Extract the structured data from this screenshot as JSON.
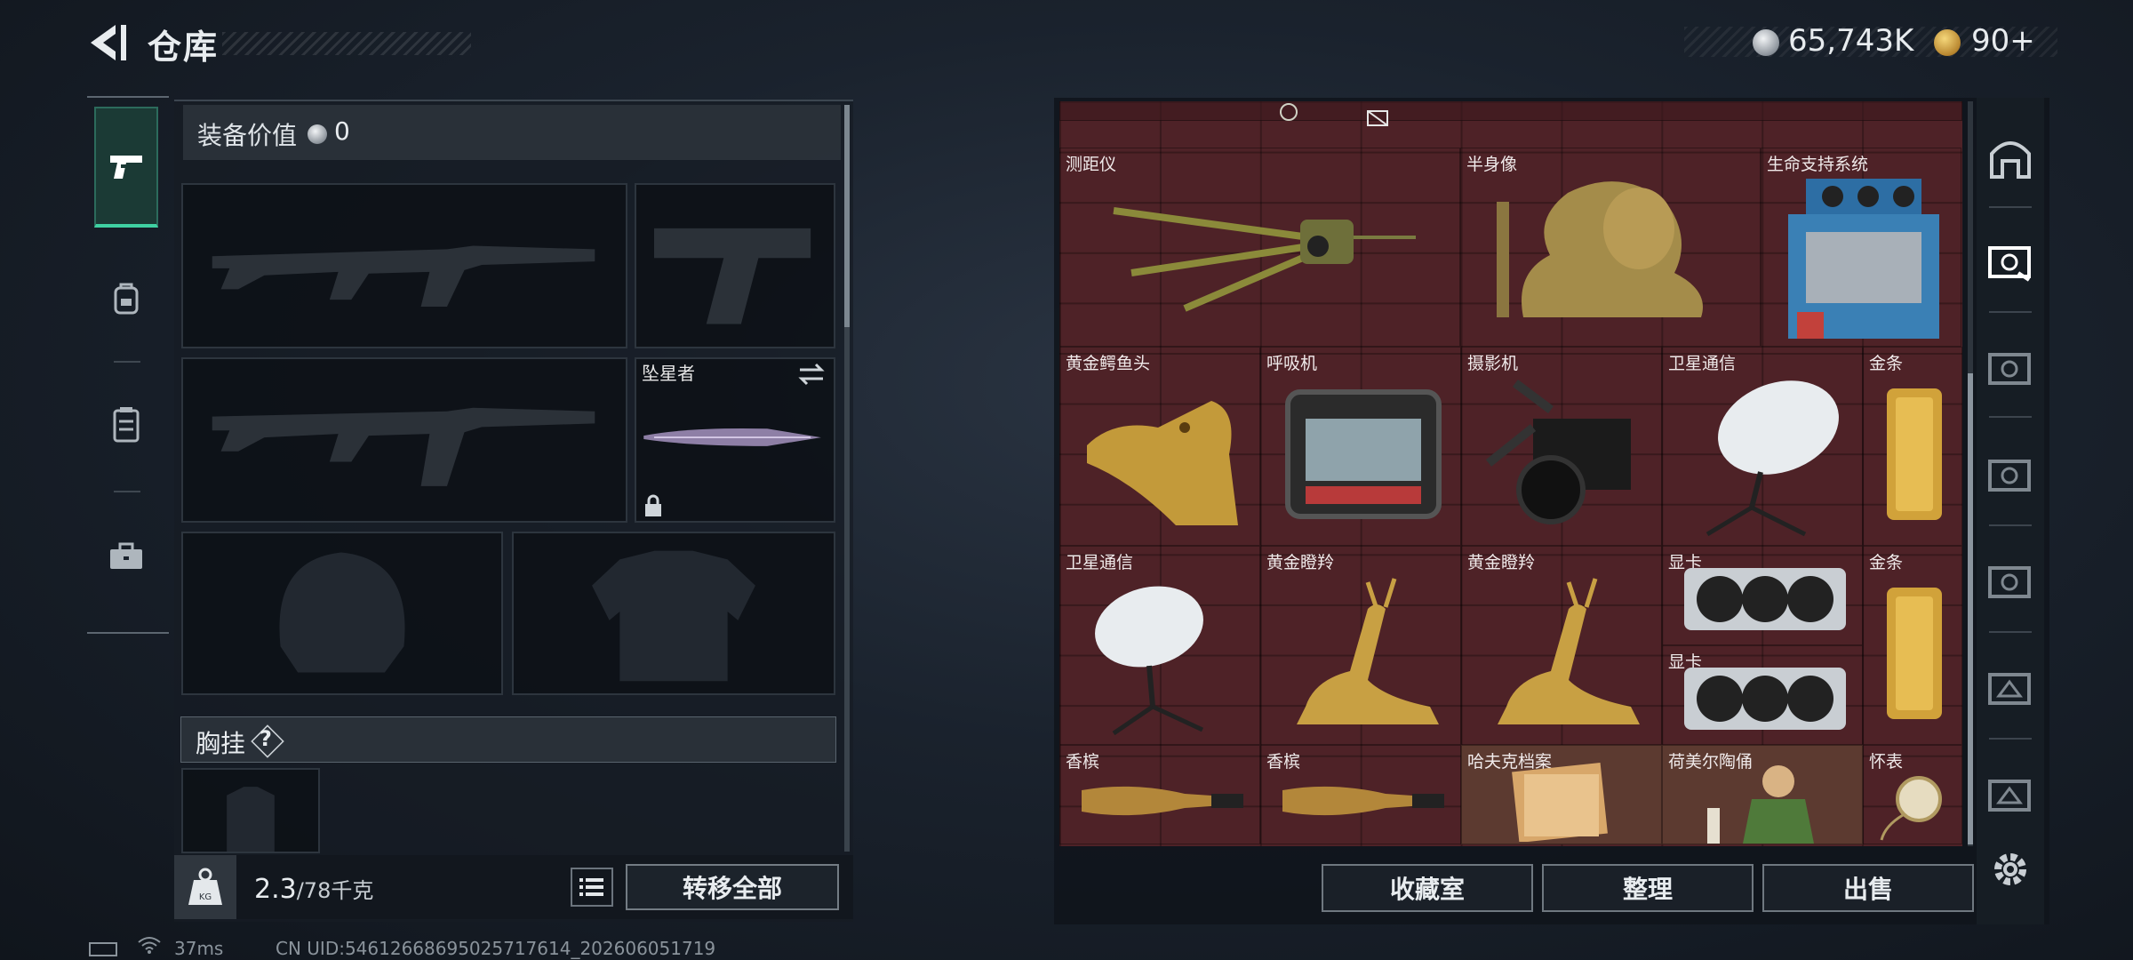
{
  "header": {
    "title": "仓库",
    "silver": "65,743K",
    "gold": "90+"
  },
  "equipment": {
    "value_label": "装备价值",
    "value": "0",
    "knife_name": "坠星者",
    "vest_label": "胸挂",
    "vest_help": "?",
    "weight_current": "2.3",
    "weight_max": "/78千克",
    "weight_icon_text": "KG",
    "transfer_all": "转移全部"
  },
  "stash": {
    "items": [
      {
        "name": "测距仪"
      },
      {
        "name": "半身像"
      },
      {
        "name": "生命支持系统"
      },
      {
        "name": "黄金鳄鱼头"
      },
      {
        "name": "呼吸机"
      },
      {
        "name": "摄影机"
      },
      {
        "name": "卫星通信"
      },
      {
        "name": "金条"
      },
      {
        "name": "卫星通信"
      },
      {
        "name": "黄金瞪羚"
      },
      {
        "name": "黄金瞪羚"
      },
      {
        "name": "显卡"
      },
      {
        "name": "金条"
      },
      {
        "name": "显卡"
      },
      {
        "name": "香槟"
      },
      {
        "name": "香槟"
      },
      {
        "name": "哈夫克档案"
      },
      {
        "name": "荷美尔陶俑"
      },
      {
        "name": "怀表"
      }
    ],
    "buttons": {
      "collection": "收藏室",
      "organize": "整理",
      "sell": "出售"
    }
  },
  "right_tabs": [
    "home-icon",
    "case-icon-active",
    "case-iv-icon",
    "case-iv-icon",
    "case-iv-icon",
    "case-iii-icon",
    "case-iii-icon",
    "settings-icon"
  ],
  "status": {
    "ping": "37ms",
    "uid": "CN UID:54612668695025717614_202606051719"
  },
  "colors": {
    "stash_bg": "#4e2227",
    "active_tab": "#3fd1a2"
  }
}
